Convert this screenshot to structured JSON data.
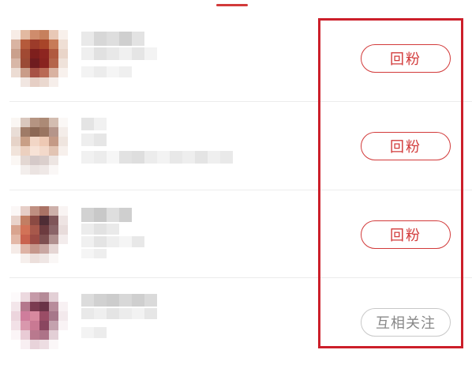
{
  "follower_list": {
    "rows": [
      {
        "action_label": "回粉",
        "action_type": "follow-back"
      },
      {
        "action_label": "回粉",
        "action_type": "follow-back"
      },
      {
        "action_label": "回粉",
        "action_type": "follow-back"
      },
      {
        "action_label": "互相关注",
        "action_type": "mutual"
      }
    ]
  },
  "colors": {
    "accent": "#d23a3a",
    "highlight_box": "#cc1f2a",
    "mutual_border": "#c8c8c8",
    "mutual_text": "#888888"
  }
}
